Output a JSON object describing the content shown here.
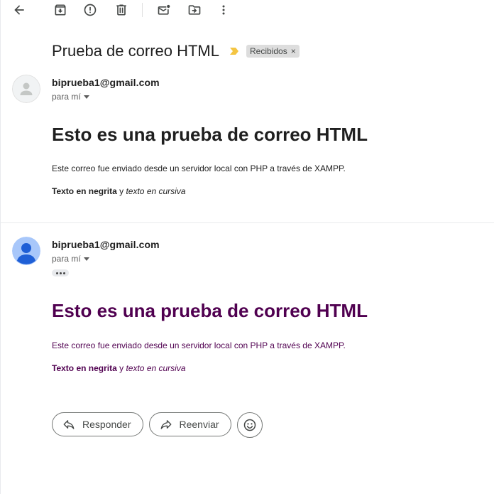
{
  "toolbar": {
    "icons": [
      "back-arrow-icon",
      "archive-icon",
      "report-spam-icon",
      "delete-icon",
      "mark-unread-icon",
      "move-to-icon",
      "more-vert-icon"
    ]
  },
  "thread": {
    "subject": "Prueba de correo HTML",
    "label": "Recibidos",
    "label_remove": "×",
    "important_color": "#f4c542"
  },
  "messages": [
    {
      "sender": "biprueba1@gmail.com",
      "to": "para mí",
      "heading": "Esto es una prueba de correo HTML",
      "body": "Este correo fue enviado desde un servidor local con PHP a través de XAMPP.",
      "bold_text": "Texto en negrita",
      "joiner": " y ",
      "italic_text": "texto en cursiva",
      "avatar": "default-person-avatar"
    },
    {
      "sender": "biprueba1@gmail.com",
      "to": "para mí",
      "heading": "Esto es una prueba de correo HTML",
      "body": "Este correo fue enviado desde un servidor local con PHP a través de XAMPP.",
      "bold_text": "Texto en negrita",
      "joiner": " y ",
      "italic_text": "texto en cursiva",
      "avatar": "blue-person-avatar",
      "text_color": "#500050"
    }
  ],
  "actions": {
    "reply": "Responder",
    "forward": "Reenviar",
    "emoji": "emoji-icon"
  }
}
